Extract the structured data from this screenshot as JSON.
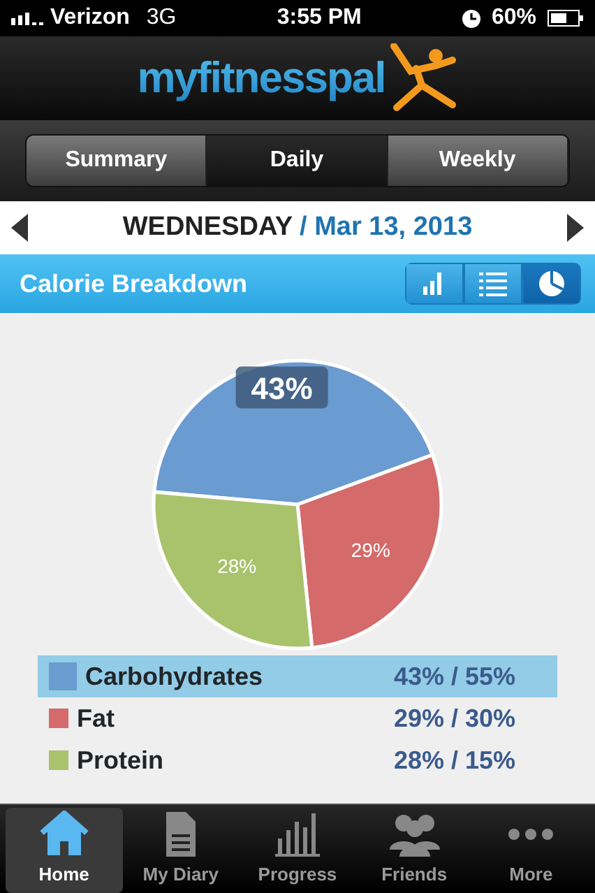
{
  "status_bar": {
    "carrier": "Verizon",
    "network": "3G",
    "time": "3:55 PM",
    "battery": "60%"
  },
  "header": {
    "logo": "myfitnesspal"
  },
  "tabs": [
    {
      "label": "Summary",
      "selected": false
    },
    {
      "label": "Daily",
      "selected": true
    },
    {
      "label": "Weekly",
      "selected": false
    }
  ],
  "date": {
    "day": "WEDNESDAY",
    "date": "/ Mar 13, 2013"
  },
  "section": {
    "title": "Calorie Breakdown",
    "views": [
      {
        "kind": "bar",
        "selected": false
      },
      {
        "kind": "list",
        "selected": false
      },
      {
        "kind": "pie",
        "selected": true
      }
    ]
  },
  "chart_data": {
    "type": "pie",
    "categories": [
      "Carbohydrates",
      "Fat",
      "Protein"
    ],
    "values": [
      43,
      29,
      28
    ],
    "value_labels": [
      "43%",
      "29%",
      "28%"
    ]
  },
  "legend": [
    {
      "value": "43% / 55%",
      "color": "#6a9bd1",
      "selected": true
    },
    {
      "value": "29% / 30%",
      "color": "#d46a6a",
      "selected": false
    },
    {
      "value": "28% / 15%",
      "color": "#a9c36c",
      "selected": false
    }
  ],
  "bottom_nav": [
    {
      "kind": "home",
      "label": "Home",
      "selected": true
    },
    {
      "kind": "diary",
      "label": "My Diary",
      "selected": false
    },
    {
      "kind": "progress",
      "label": "Progress",
      "selected": false
    },
    {
      "kind": "friends",
      "label": "Friends",
      "selected": false
    },
    {
      "kind": "more",
      "label": "More",
      "selected": false
    }
  ]
}
